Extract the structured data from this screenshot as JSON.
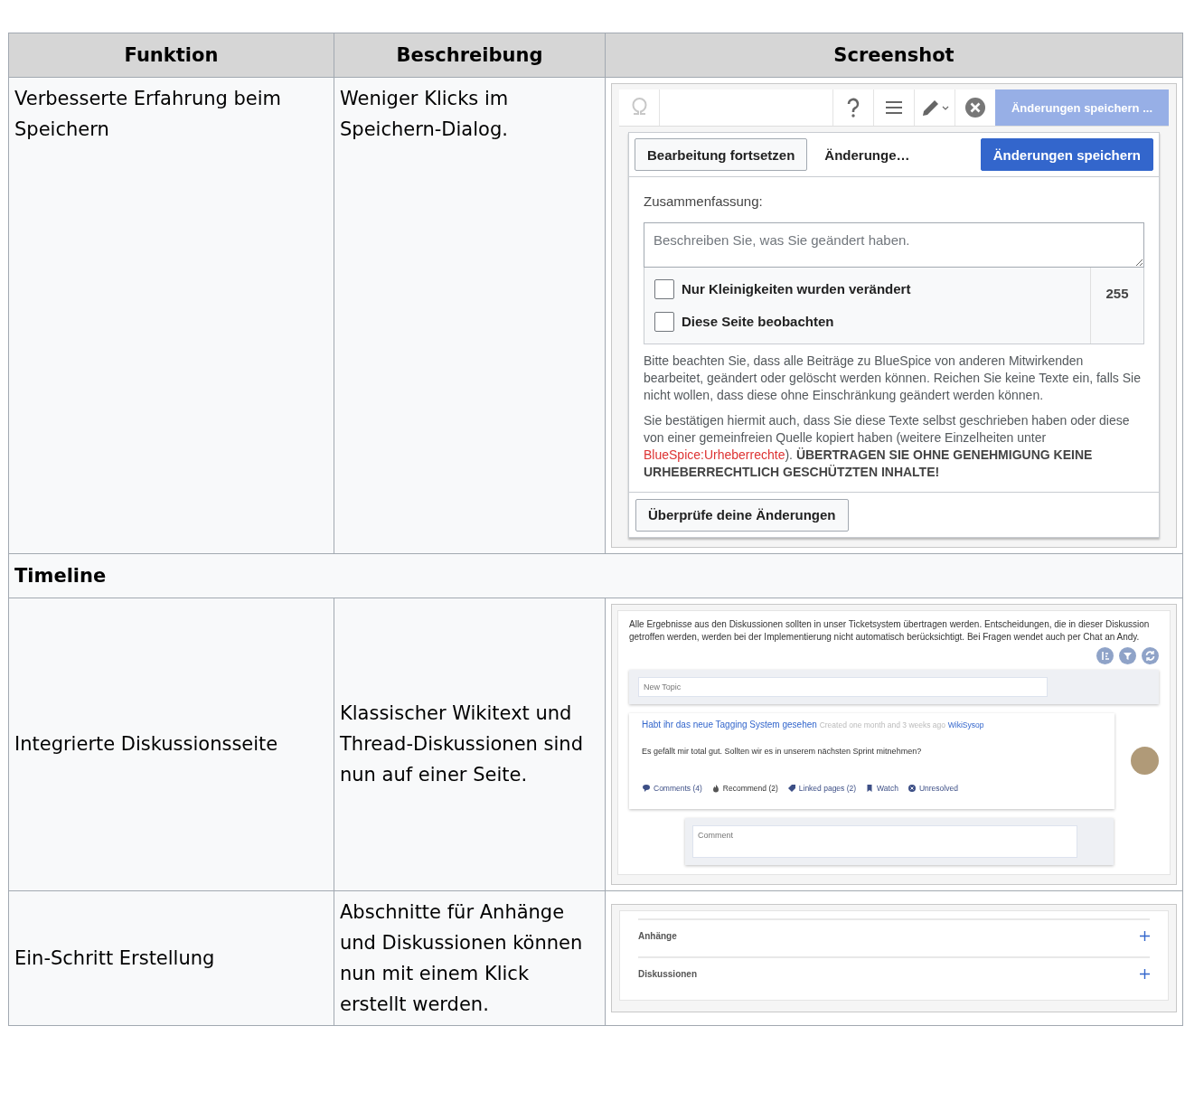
{
  "table": {
    "columns": [
      "Funktion",
      "Beschreibung",
      "Screenshot"
    ],
    "rows": [
      {
        "kind": "feature",
        "funktion": "Verbesserte Erfahrung beim Speichern",
        "beschreibung": "Weniger Klicks im Speichern-Dialog.",
        "screenshot": {
          "kind": "save_dialog",
          "toolbar_save": "Änderungen speichern ...",
          "tabs": [
            {
              "label": "Bearbeitung fortsetzen",
              "kind": "outlined"
            },
            {
              "label": "Änderunge…",
              "kind": "plain"
            },
            {
              "label": "Änderungen speichern",
              "kind": "primary"
            }
          ],
          "summary_label": "Zusammenfassung:",
          "summary_placeholder": "Beschreiben Sie, was Sie geändert haben.",
          "counter": "255",
          "checkboxes": [
            {
              "label": "Nur Kleinigkeiten wurden verändert",
              "checked": false
            },
            {
              "label": "Diese Seite beobachten",
              "checked": false
            }
          ],
          "notice": "Bitte beachten Sie, dass alle Beiträge zu BlueSpice von anderen Mitwirkenden bearbeitet, geändert oder gelöscht werden können. Reichen Sie keine Texte ein, falls Sie nicht wollen, dass diese ohne Einschränkung geändert werden können.",
          "license_before": "Sie bestätigen hiermit auch, dass Sie diese Texte selbst geschrieben haben oder diese von einer gemeinfreien Quelle kopiert haben (weitere Einzelheiten unter ",
          "license_link": "BlueSpice:Urheberrechte",
          "license_after": "). ",
          "license_warning": "ÜBERTRAGEN SIE OHNE GENEHMIGUNG KEINE URHEBERRECHTLICH GESCHÜTZTEN INHALTE!",
          "review_button": "Überprüfe deine Änderungen"
        }
      },
      {
        "kind": "section",
        "title": "Timeline"
      },
      {
        "kind": "feature",
        "funktion": "Integrierte Diskussionsseite",
        "beschreibung": "Klassischer Wikitext und Thread-Diskussionen sind nun auf einer Seite.",
        "screenshot": {
          "kind": "discussion",
          "intro": "Alle Ergebnisse aus den Diskussionen sollten in unser Ticketsystem übertragen werden. Entscheidungen, die in dieser Diskussion getroffen werden, werden bei der Implementierung nicht automatisch berücksichtigt. Bei Fragen wendet auch per Chat an Andy.",
          "new_topic_placeholder": "New Topic",
          "topic": {
            "title": "Habt ihr das neue Tagging System gesehen",
            "meta": "Created one month and 3 weeks ago",
            "author": "WikiSysop",
            "body": "Es gefällt mir total gut. Sollten wir es in unserem nächsten Sprint mitnehmen?",
            "actions": [
              {
                "kind": "comments",
                "label": "Comments (4)"
              },
              {
                "kind": "recommend",
                "label": "Recommend (2)"
              },
              {
                "kind": "linked",
                "label": "Linked pages (2)"
              },
              {
                "kind": "watch",
                "label": "Watch"
              },
              {
                "kind": "unresolved",
                "label": "Unresolved"
              }
            ]
          },
          "comment_placeholder": "Comment"
        }
      },
      {
        "kind": "feature",
        "funktion": "Ein-Schritt Erstellung",
        "beschreibung": "Abschnitte für Anhänge und Diskussionen können nun mit einem Klick erstellt werden.",
        "screenshot": {
          "kind": "sections",
          "sections": [
            {
              "label": "Anhänge"
            },
            {
              "label": "Diskussionen"
            }
          ]
        }
      }
    ]
  }
}
